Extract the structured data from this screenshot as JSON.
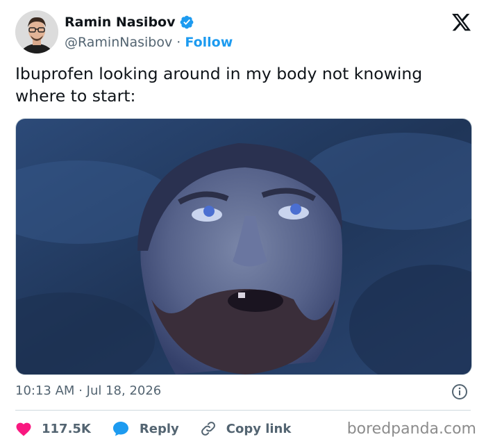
{
  "author": {
    "name": "Ramin Nasibov",
    "handle": "@RaminNasibov",
    "separator": "·",
    "follow_label": "Follow"
  },
  "tweet": {
    "text": "Ibuprofen looking around in my body not knowing where to start:"
  },
  "meta": {
    "time": "10:13 AM",
    "separator": "·",
    "date": "Jul 18, 2026"
  },
  "actions": {
    "likes": "117.5K",
    "reply_label": "Reply",
    "copy_link_label": "Copy link"
  },
  "watermark": "boredpanda.com",
  "colors": {
    "accent": "#1d9bf0",
    "like": "#f91880",
    "secondary_text": "#536471"
  },
  "icons": [
    "verified-badge-icon",
    "x-logo-icon",
    "info-icon",
    "heart-icon",
    "reply-bubble-icon",
    "link-icon"
  ]
}
